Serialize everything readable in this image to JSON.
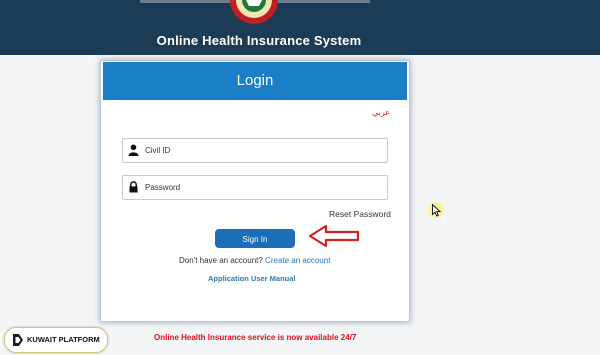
{
  "header": {
    "title": "Online Health Insurance System",
    "background": "#1c3c55",
    "emblem_icon": "kuwait-emblem-icon"
  },
  "login": {
    "heading": "Login",
    "header_color": "#1a7fc6",
    "language_link": "عربي",
    "civil_id": {
      "placeholder": "Civil ID",
      "value": "",
      "icon": "user-icon"
    },
    "password": {
      "placeholder": "Password",
      "value": "",
      "icon": "lock-icon"
    },
    "reset_password": "Reset Password",
    "sign_in": "Sign In",
    "account_prompt": "Don't have an account?",
    "create_account": "Create an account",
    "manual": "Application User Manual"
  },
  "footer": {
    "availability": "Online Health Insurance service is now available 24/7",
    "availability_color": "#d1131a"
  },
  "watermark": {
    "text": "KUWAIT PLATFORM"
  },
  "annotation": {
    "arrow_icon": "red-outline-arrow-icon",
    "arrow_color": "#d42020"
  }
}
